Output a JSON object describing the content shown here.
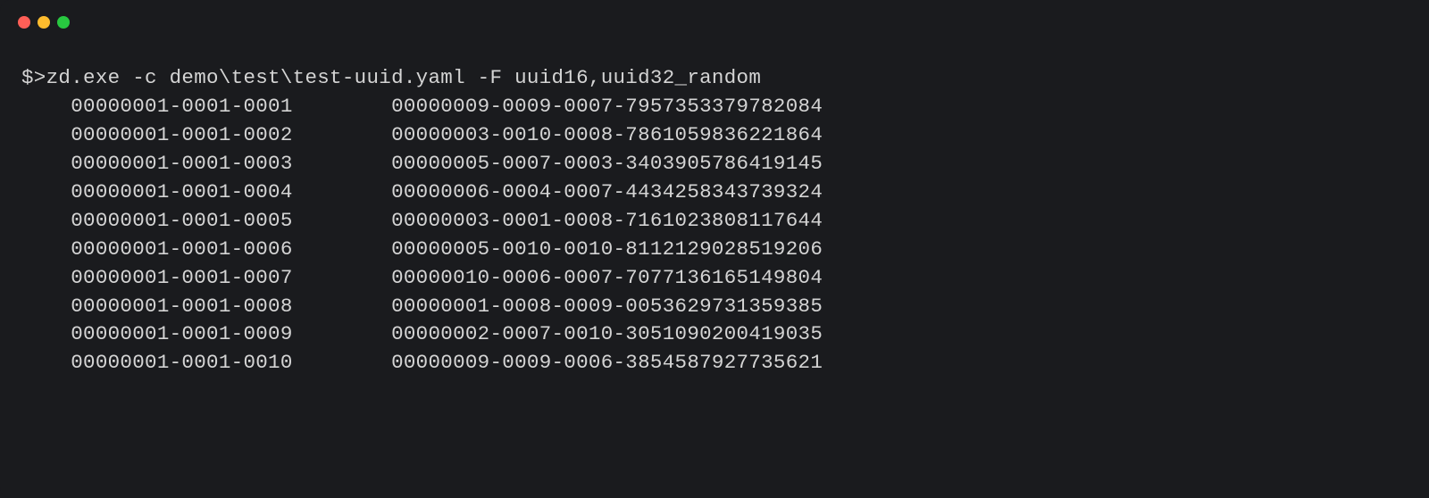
{
  "command": {
    "prompt": "$>",
    "text": "zd.exe -c demo\\test\\test-uuid.yaml -F uuid16,uuid32_random"
  },
  "output": {
    "rows": [
      {
        "col1": "00000001-0001-0001",
        "col2": "00000009-0009-0007-7957353379782084"
      },
      {
        "col1": "00000001-0001-0002",
        "col2": "00000003-0010-0008-7861059836221864"
      },
      {
        "col1": "00000001-0001-0003",
        "col2": "00000005-0007-0003-3403905786419145"
      },
      {
        "col1": "00000001-0001-0004",
        "col2": "00000006-0004-0007-4434258343739324"
      },
      {
        "col1": "00000001-0001-0005",
        "col2": "00000003-0001-0008-7161023808117644"
      },
      {
        "col1": "00000001-0001-0006",
        "col2": "00000005-0010-0010-8112129028519206"
      },
      {
        "col1": "00000001-0001-0007",
        "col2": "00000010-0006-0007-7077136165149804"
      },
      {
        "col1": "00000001-0001-0008",
        "col2": "00000001-0008-0009-0053629731359385"
      },
      {
        "col1": "00000001-0001-0009",
        "col2": "00000002-0007-0010-3051090200419035"
      },
      {
        "col1": "00000001-0001-0010",
        "col2": "00000009-0009-0006-3854587927735621"
      }
    ]
  }
}
